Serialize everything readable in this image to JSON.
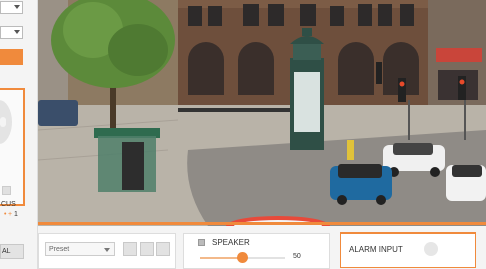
{
  "left_panel": {
    "focus_label": "CUS",
    "focus_value": "1",
    "optical_label": "AL"
  },
  "bottom": {
    "preset_placeholder": "Preset",
    "speaker_label": "SPEAKER",
    "speaker_volume": "50",
    "speaker_volume_fraction": 0.5,
    "alarm_label": "ALARM INPUT"
  },
  "colors": {
    "accent": "#f08a3c"
  }
}
